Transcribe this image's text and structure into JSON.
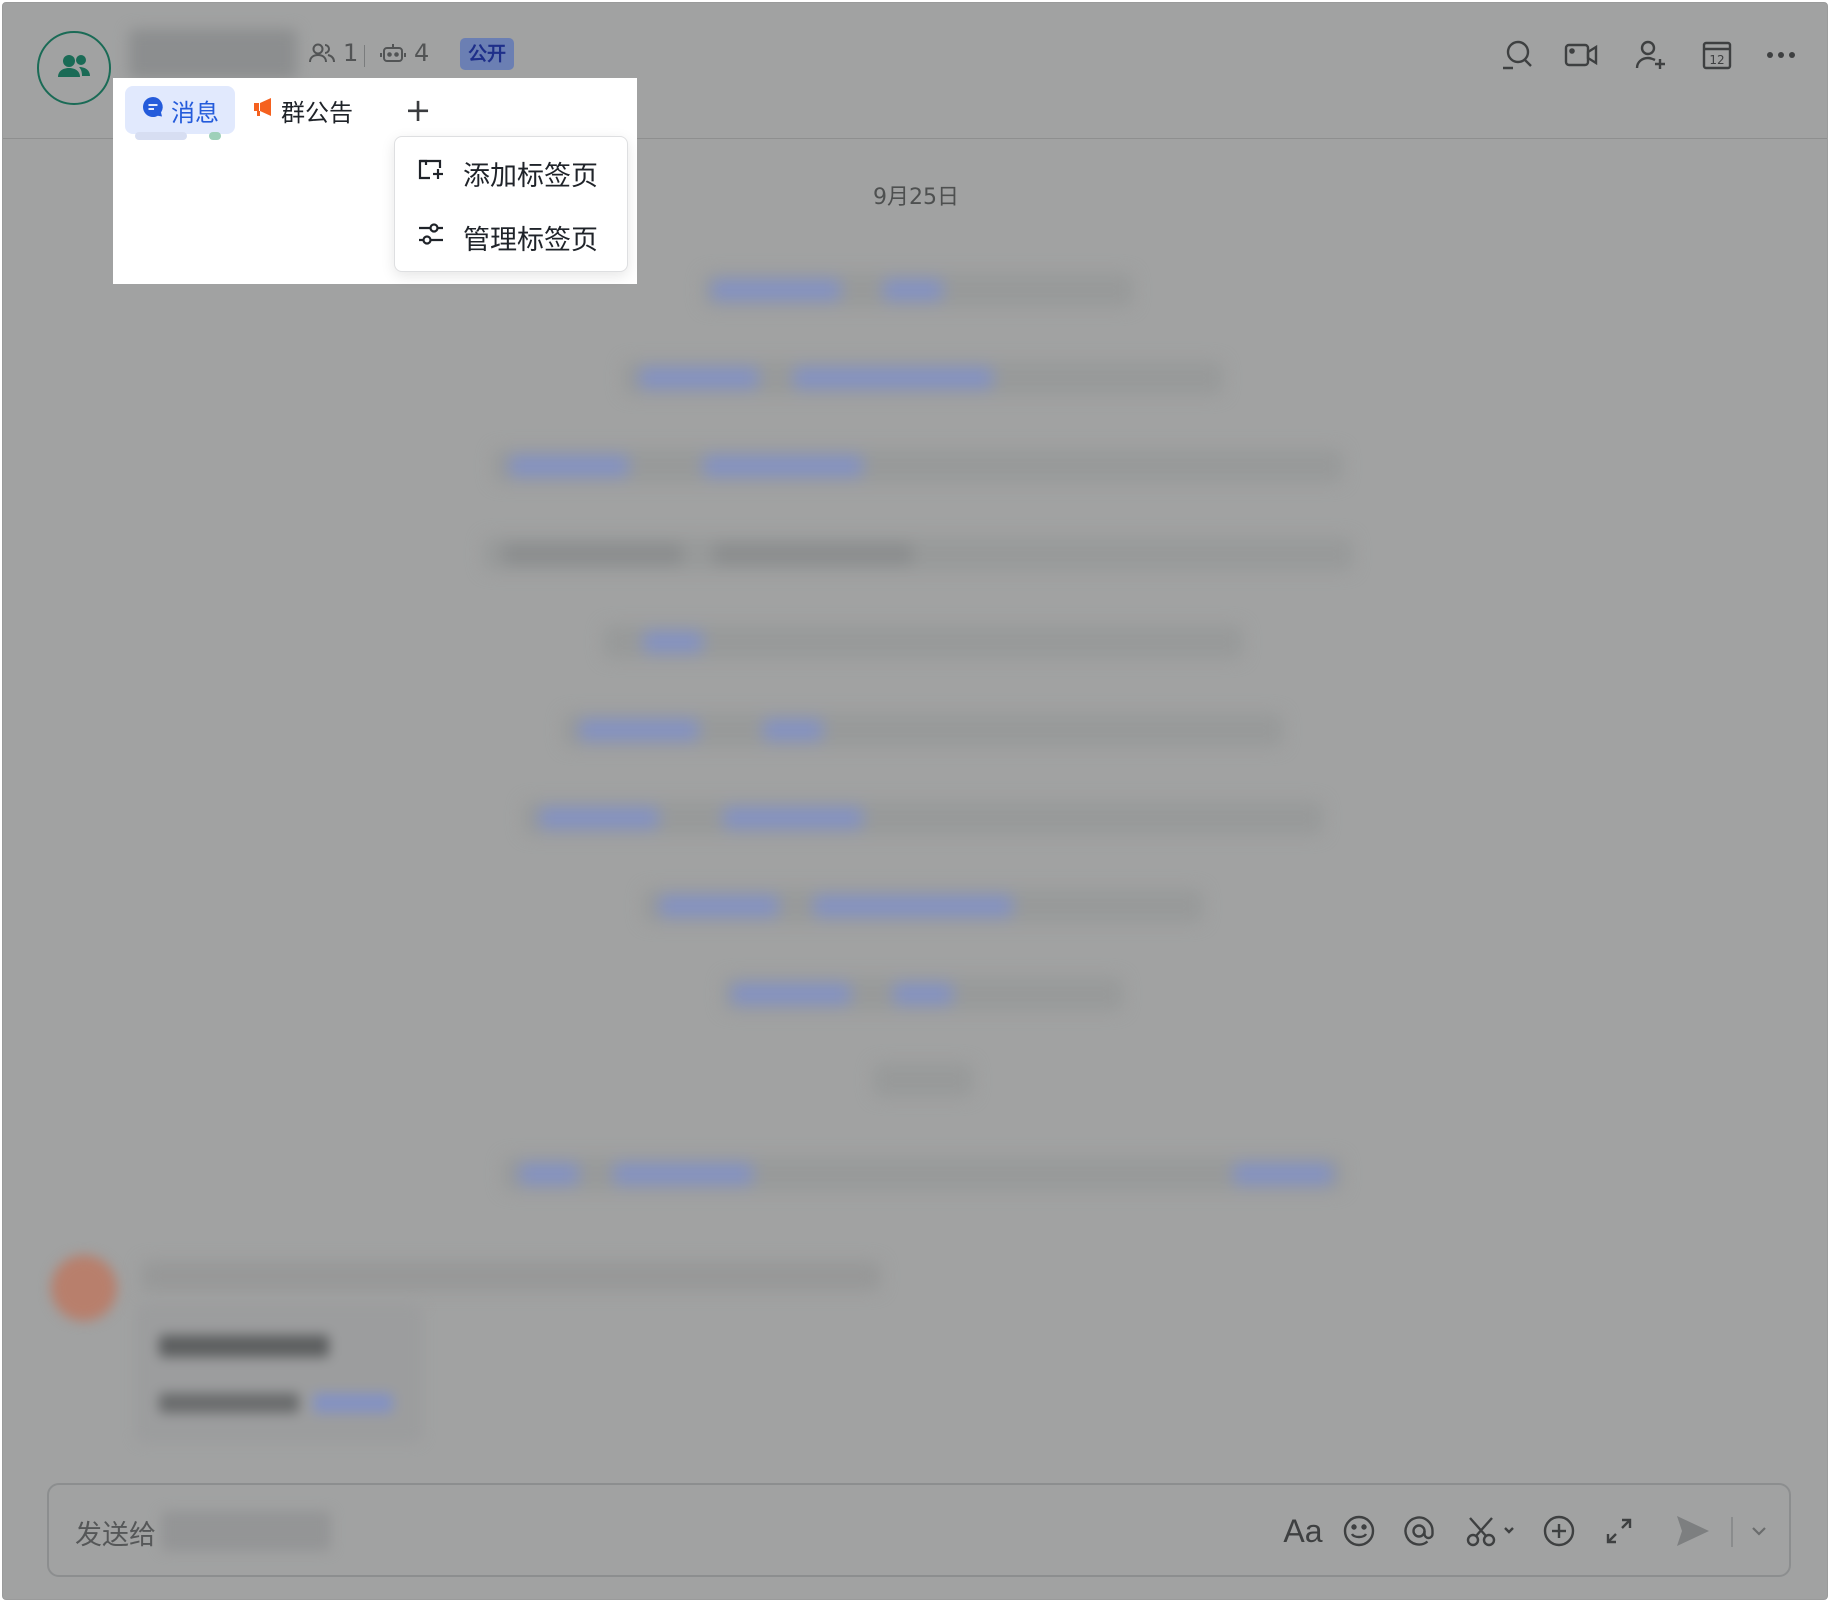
{
  "header": {
    "member_count": "1",
    "bot_count": "4",
    "visibility_badge": "公开"
  },
  "tabs": [
    {
      "label": "消息",
      "active": true,
      "icon": "chat-bubble-icon"
    },
    {
      "label": "群公告",
      "active": false,
      "icon": "megaphone-icon"
    }
  ],
  "add_tab_symbol": "+",
  "tab_menu": {
    "items": [
      {
        "label": "添加标签页",
        "icon": "add-tab-icon"
      },
      {
        "label": "管理标签页",
        "icon": "sliders-icon"
      }
    ]
  },
  "chat": {
    "date_divider": "9月25日"
  },
  "composer": {
    "placeholder_prefix": "发送给",
    "format_label": "Aa"
  },
  "header_actions": [
    "search-icon",
    "video-call-icon",
    "add-member-icon",
    "calendar-icon",
    "more-icon"
  ],
  "calendar_day": "12",
  "colors": {
    "accent": "#245bdb",
    "active_tab_bg": "#e1e9fd",
    "megaphone": "#f5611f",
    "avatar_ring": "#1a6b56",
    "overlay": "#a1a2a2"
  }
}
